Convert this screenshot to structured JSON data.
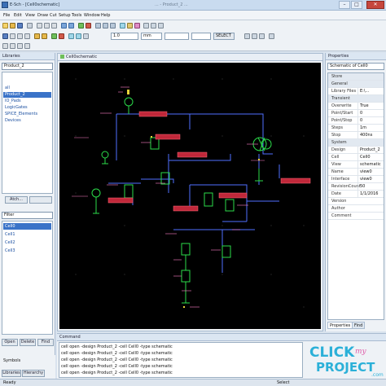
{
  "window": {
    "title": "E-Sch - [Cell0schematic]",
    "center_title": "... - Product_2 ...",
    "minimize": "–",
    "maximize": "□",
    "close": "✕"
  },
  "menu": [
    "File",
    "Edit",
    "View",
    "Draw",
    "Cut",
    "Setup",
    "Tools",
    "Window",
    "Help"
  ],
  "toolbar": {
    "zoom_field": "1.0",
    "units_field": "mm",
    "select_button": "SELECT"
  },
  "libraries": {
    "header": "Libraries",
    "selected": "Product_2",
    "items": [
      "all",
      "Product_2",
      "IO_Pads",
      "LogicGates",
      "SPICE_Elements",
      "Devices"
    ],
    "selected_index": 1,
    "attach_button": "Atch...",
    "filter_label": "Filter",
    "cells": [
      "Cell0",
      "Cell1",
      "Cell2",
      "Cell3"
    ],
    "selected_cell_index": 0,
    "open_button": "Open",
    "delete_button": "Delete",
    "find_button": "Find",
    "bottom_tab_libs": "Libraries",
    "bottom_tab_hier": "Hierarchy",
    "status_symbols": "Symbols"
  },
  "schematic": {
    "tab_label": "Cell0schematic"
  },
  "properties": {
    "header": "Properties",
    "subtitle": "Schematic of Cell0",
    "rows": [
      {
        "type": "group",
        "k": "Store",
        "v": ""
      },
      {
        "type": "group",
        "k": "General",
        "v": ""
      },
      {
        "type": "row",
        "k": "Library Files",
        "v": "E:\\..."
      },
      {
        "type": "group",
        "k": "Transient",
        "v": ""
      },
      {
        "type": "row",
        "k": "Overwrite",
        "v": "True"
      },
      {
        "type": "row",
        "k": "Point/Start",
        "v": "0"
      },
      {
        "type": "row",
        "k": "Point/Stop",
        "v": "0"
      },
      {
        "type": "row",
        "k": "Steps",
        "v": "1m"
      },
      {
        "type": "row",
        "k": "Stop",
        "v": "400ns"
      },
      {
        "type": "group",
        "k": "System",
        "v": ""
      },
      {
        "type": "row",
        "k": "Design",
        "v": "Product_2"
      },
      {
        "type": "row",
        "k": "Cell",
        "v": "Cell0"
      },
      {
        "type": "row",
        "k": "View",
        "v": "schematic"
      },
      {
        "type": "row",
        "k": "Name",
        "v": "view0"
      },
      {
        "type": "row",
        "k": "Interface",
        "v": "view0"
      },
      {
        "type": "row",
        "k": "RevisionCount",
        "v": "50"
      },
      {
        "type": "row",
        "k": "Date",
        "v": "1/1/2016"
      },
      {
        "type": "row",
        "k": "Version",
        "v": ""
      },
      {
        "type": "row",
        "k": "Author",
        "v": ""
      },
      {
        "type": "row",
        "k": "Comment",
        "v": ""
      }
    ],
    "tab_properties": "Properties",
    "tab_find": "Find"
  },
  "console": {
    "header": "Command",
    "lines": [
      "cell open -design Product_2 -cell Cell0 -type schematic",
      "cell open -design Product_2 -cell Cell0 -type schematic",
      "cell open -design Product_2 -cell Cell0 -type schematic",
      "cell open -design Product_2 -cell Cell0 -type schematic",
      "cell open -design Product_2 -cell Cell0 -type schematic"
    ]
  },
  "statusbar": {
    "left": "Ready",
    "right": "Select"
  },
  "watermark": {
    "text1": "CLICK",
    "text2": "PROJECT",
    "text3": ".com"
  },
  "colors": {
    "canvas": "#000000",
    "wire_blue": "#4f6fff",
    "wire_green": "#2bdc4a",
    "label_pink": "#ff7fc8",
    "block_red": "#c0283a",
    "accent": "#3a73c8"
  }
}
